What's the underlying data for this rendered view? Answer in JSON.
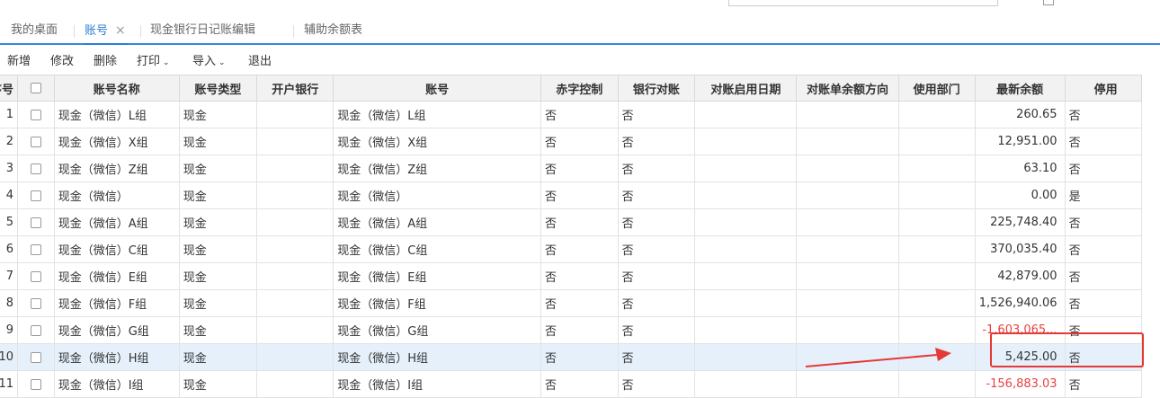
{
  "topbar": {
    "crumb": "",
    "search_placeholder": ""
  },
  "tabs": [
    {
      "label": "我的桌面"
    },
    {
      "label": "账号",
      "close": "×"
    },
    {
      "label": "现金银行日记账编辑"
    },
    {
      "label": "辅助余额表"
    }
  ],
  "toolbar": {
    "add": "新增",
    "edit": "修改",
    "delete": "删除",
    "print": "打印",
    "import": "导入",
    "exit": "退出",
    "caret": "⌄"
  },
  "table": {
    "columns": [
      "序号",
      "",
      "账号名称",
      "账号类型",
      "开户银行",
      "账号",
      "赤字控制",
      "银行对账",
      "对账启用日期",
      "对账单余额方向",
      "使用部门",
      "最新余额",
      "停用"
    ],
    "rows": [
      {
        "seq": "1",
        "name": "现金（微信）L组",
        "type": "现金",
        "bank": "",
        "account": "现金（微信）L组",
        "deficit": "否",
        "reconcile": "否",
        "start_date": "",
        "direction": "",
        "dept": "",
        "balance": "260.65",
        "disabled": "否"
      },
      {
        "seq": "2",
        "name": "现金（微信）X组",
        "type": "现金",
        "bank": "",
        "account": "现金（微信）X组",
        "deficit": "否",
        "reconcile": "否",
        "start_date": "",
        "direction": "",
        "dept": "",
        "balance": "12,951.00",
        "disabled": "否"
      },
      {
        "seq": "3",
        "name": "现金（微信）Z组",
        "type": "现金",
        "bank": "",
        "account": "现金（微信）Z组",
        "deficit": "否",
        "reconcile": "否",
        "start_date": "",
        "direction": "",
        "dept": "",
        "balance": "63.10",
        "disabled": "否"
      },
      {
        "seq": "4",
        "name": "现金（微信）",
        "type": "现金",
        "bank": "",
        "account": "现金（微信）",
        "deficit": "否",
        "reconcile": "否",
        "start_date": "",
        "direction": "",
        "dept": "",
        "balance": "0.00",
        "disabled": "是"
      },
      {
        "seq": "5",
        "name": "现金（微信）A组",
        "type": "现金",
        "bank": "",
        "account": "现金（微信）A组",
        "deficit": "否",
        "reconcile": "否",
        "start_date": "",
        "direction": "",
        "dept": "",
        "balance": "225,748.40",
        "disabled": "否"
      },
      {
        "seq": "6",
        "name": "现金（微信）C组",
        "type": "现金",
        "bank": "",
        "account": "现金（微信）C组",
        "deficit": "否",
        "reconcile": "否",
        "start_date": "",
        "direction": "",
        "dept": "",
        "balance": "370,035.40",
        "disabled": "否"
      },
      {
        "seq": "7",
        "name": "现金（微信）E组",
        "type": "现金",
        "bank": "",
        "account": "现金（微信）E组",
        "deficit": "否",
        "reconcile": "否",
        "start_date": "",
        "direction": "",
        "dept": "",
        "balance": "42,879.00",
        "disabled": "否"
      },
      {
        "seq": "8",
        "name": "现金（微信）F组",
        "type": "现金",
        "bank": "",
        "account": "现金（微信）F组",
        "deficit": "否",
        "reconcile": "否",
        "start_date": "",
        "direction": "",
        "dept": "",
        "balance": "1,526,940.06",
        "disabled": "否"
      },
      {
        "seq": "9",
        "name": "现金（微信）G组",
        "type": "现金",
        "bank": "",
        "account": "现金（微信）G组",
        "deficit": "否",
        "reconcile": "否",
        "start_date": "",
        "direction": "",
        "dept": "",
        "balance": "-1,603,065...",
        "disabled": "否",
        "negative": true
      },
      {
        "seq": "10",
        "name": "现金（微信）H组",
        "type": "现金",
        "bank": "",
        "account": "现金（微信）H组",
        "deficit": "否",
        "reconcile": "否",
        "start_date": "",
        "direction": "",
        "dept": "",
        "balance": "5,425.00",
        "disabled": "否",
        "selected": true
      },
      {
        "seq": "11",
        "name": "现金（微信）I组",
        "type": "现金",
        "bank": "",
        "account": "现金（微信）I组",
        "deficit": "否",
        "reconcile": "否",
        "start_date": "",
        "direction": "",
        "dept": "",
        "balance": "-156,883.03",
        "disabled": "否",
        "negative": true
      }
    ]
  },
  "annotation": {
    "color": "#e53935"
  }
}
